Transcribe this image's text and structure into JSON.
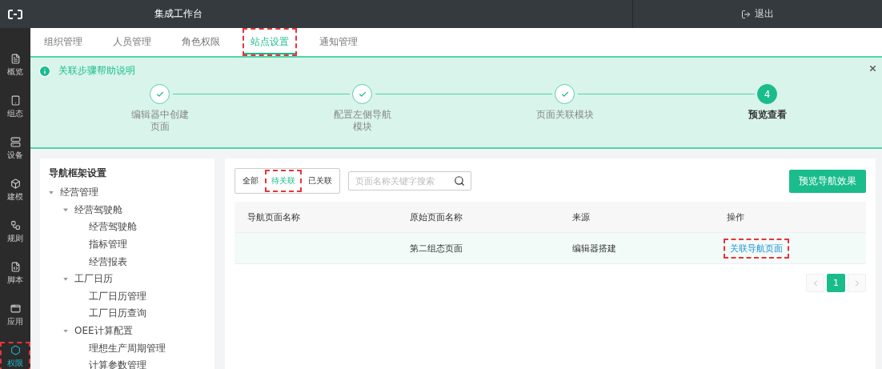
{
  "header": {
    "title": "集成工作台",
    "logout": "退出"
  },
  "sidebar": {
    "items": [
      {
        "label": "概览",
        "selected": false,
        "annotated": false
      },
      {
        "label": "组态",
        "selected": false,
        "annotated": false
      },
      {
        "label": "设备",
        "selected": false,
        "annotated": false
      },
      {
        "label": "建模",
        "selected": false,
        "annotated": false
      },
      {
        "label": "规则",
        "selected": false,
        "annotated": false
      },
      {
        "label": "脚本",
        "selected": false,
        "annotated": false
      },
      {
        "label": "应用",
        "selected": false,
        "annotated": false
      },
      {
        "label": "权限",
        "selected": true,
        "annotated": true
      }
    ]
  },
  "tabs": [
    {
      "label": "组织管理",
      "selected": false,
      "annotated": false
    },
    {
      "label": "人员管理",
      "selected": false,
      "annotated": false
    },
    {
      "label": "角色权限",
      "selected": false,
      "annotated": false
    },
    {
      "label": "站点设置",
      "selected": true,
      "annotated": true
    },
    {
      "label": "通知管理",
      "selected": false,
      "annotated": false
    }
  ],
  "help": {
    "title": "关联步骤帮助说明",
    "steps": [
      {
        "label": "编辑器中创建页面",
        "kind": "done"
      },
      {
        "label": "配置左侧导航模块",
        "kind": "done"
      },
      {
        "label": "页面关联模块",
        "kind": "done"
      },
      {
        "label": "预览查看",
        "kind": "current",
        "number": "4"
      }
    ]
  },
  "nav_tree": {
    "title": "导航框架设置",
    "items": [
      {
        "label": "经营管理",
        "expanded": true,
        "children": [
          {
            "label": "经营驾驶舱",
            "expanded": true,
            "children": [
              {
                "label": "经营驾驶舱"
              },
              {
                "label": "指标管理"
              },
              {
                "label": "经营报表"
              }
            ]
          },
          {
            "label": "工厂日历",
            "expanded": true,
            "children": [
              {
                "label": "工厂日历管理"
              },
              {
                "label": "工厂日历查询"
              }
            ]
          },
          {
            "label": "OEE计算配置",
            "expanded": true,
            "children": [
              {
                "label": "理想生产周期管理"
              },
              {
                "label": "计算参数管理"
              }
            ]
          }
        ]
      }
    ]
  },
  "filters": [
    {
      "label": "全部",
      "selected": false,
      "annotated": false
    },
    {
      "label": "待关联",
      "selected": true,
      "annotated": true
    },
    {
      "label": "已关联",
      "selected": false,
      "annotated": false
    }
  ],
  "search": {
    "placeholder": "页面名称关键字搜索"
  },
  "preview_button": "预览导航效果",
  "table": {
    "columns": [
      "导航页面名称",
      "原始页面名称",
      "来源",
      "操作"
    ],
    "rows": [
      {
        "original_name": "第二组态页面",
        "source": "编辑器搭建",
        "action": {
          "text": "关联导航页面",
          "annotated": true
        }
      }
    ]
  },
  "pagination": {
    "pages": [
      {
        "label": "1",
        "selected": true
      }
    ]
  }
}
